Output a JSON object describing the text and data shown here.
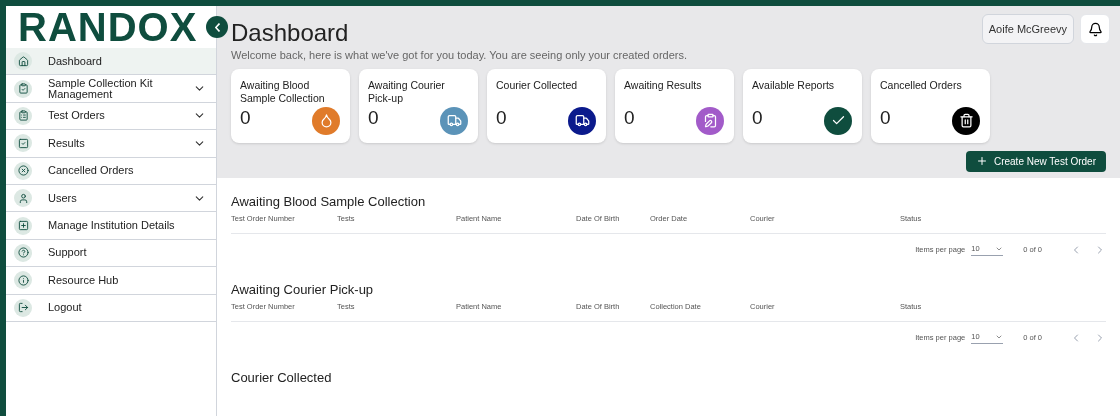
{
  "sidebar": {
    "logo": "RANDOX",
    "items": [
      {
        "label": "Dashboard",
        "expandable": false,
        "selected": true
      },
      {
        "label": "Sample Collection Kit Management",
        "expandable": true,
        "selected": false
      },
      {
        "label": "Test Orders",
        "expandable": true,
        "selected": false
      },
      {
        "label": "Results",
        "expandable": true,
        "selected": false
      },
      {
        "label": "Cancelled Orders",
        "expandable": false,
        "selected": false
      },
      {
        "label": "Users",
        "expandable": true,
        "selected": false
      },
      {
        "label": "Manage Institution Details",
        "expandable": false,
        "selected": false
      },
      {
        "label": "Support",
        "expandable": false,
        "selected": false
      },
      {
        "label": "Resource Hub",
        "expandable": false,
        "selected": false
      },
      {
        "label": "Logout",
        "expandable": false,
        "selected": false
      }
    ]
  },
  "header": {
    "title": "Dashboard",
    "subtitle": "Welcome back, here is what we've got for you today. You are seeing only your created orders.",
    "user": "Aoife McGreevy"
  },
  "cards": [
    {
      "label": "Awaiting Blood Sample Collection",
      "count": "0",
      "color": "#e07b2a"
    },
    {
      "label": "Awaiting Courier Pick-up",
      "count": "0",
      "color": "#5b93b8"
    },
    {
      "label": "Courier Collected",
      "count": "0",
      "color": "#0b1a8c"
    },
    {
      "label": "Awaiting Results",
      "count": "0",
      "color": "#a25bc9"
    },
    {
      "label": "Available Reports",
      "count": "0",
      "color": "#0f4d3e"
    },
    {
      "label": "Cancelled Orders",
      "count": "0",
      "color": "#000000"
    }
  ],
  "create_button": "Create New Test Order",
  "sections": [
    {
      "title": "Awaiting Blood Sample Collection",
      "columns": [
        "Test Order Number",
        "Tests",
        "Patient Name",
        "Date Of Birth",
        "Order Date",
        "Courier",
        "Status"
      ],
      "items_per_page_label": "Items per page",
      "items_per_page": "10",
      "range": "0 of 0"
    },
    {
      "title": "Awaiting Courier Pick-up",
      "columns": [
        "Test Order Number",
        "Tests",
        "Patient Name",
        "Date Of Birth",
        "Collection Date",
        "Courier",
        "Status"
      ],
      "items_per_page_label": "Items per page",
      "items_per_page": "10",
      "range": "0 of 0"
    },
    {
      "title": "Courier Collected"
    }
  ]
}
